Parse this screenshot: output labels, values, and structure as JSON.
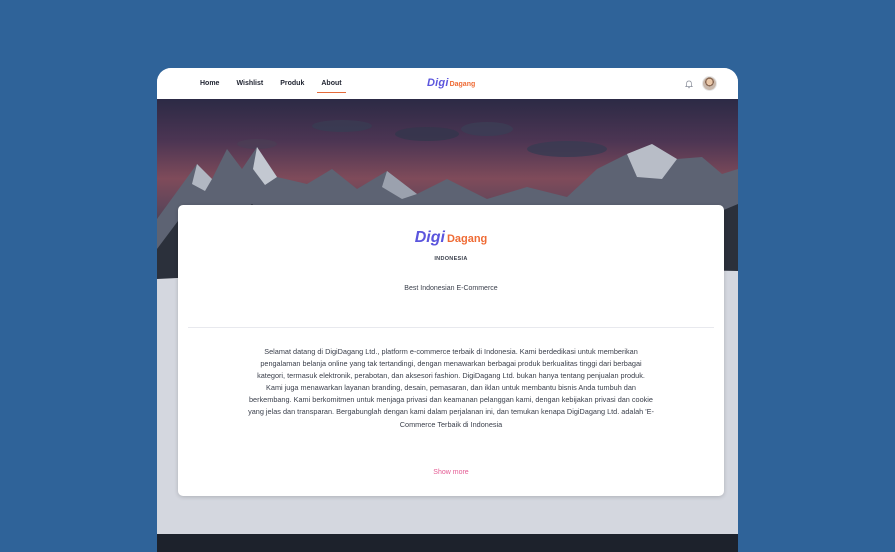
{
  "nav": {
    "links": [
      {
        "label": "Home",
        "active": false
      },
      {
        "label": "Wishlist",
        "active": false
      },
      {
        "label": "Produk",
        "active": false
      },
      {
        "label": "About",
        "active": true
      }
    ],
    "brand": {
      "digi": "Digi",
      "dagang": "Dagang"
    },
    "icons": {
      "notification": "bell-icon",
      "user": "avatar"
    }
  },
  "about": {
    "logo": {
      "digi": "Digi",
      "dagang": "Dagang"
    },
    "country": "INDONESIA",
    "tagline": "Best Indonesian E-Commerce",
    "description": "Selamat datang di DigiDagang Ltd., platform e-commerce terbaik di Indonesia. Kami berdedikasi untuk memberikan pengalaman belanja online yang tak tertandingi, dengan menawarkan berbagai produk berkualitas tinggi dari berbagai kategori, termasuk elektronik, perabotan, dan aksesori fashion. DigiDagang Ltd. bukan hanya tentang penjualan produk. Kami juga menawarkan layanan branding, desain, pemasaran, dan iklan untuk membantu bisnis Anda tumbuh dan berkembang. Kami berkomitmen untuk menjaga privasi dan keamanan pelanggan kami, dengan kebijakan privasi dan cookie yang jelas dan transparan. Bergabunglah dengan kami dalam perjalanan ini, dan temukan kenapa DigiDagang Ltd. adalah 'E-Commerce Terbaik di Indonesia",
    "show_more": "Show more"
  },
  "colors": {
    "background": "#2f6399",
    "brand_primary": "#5b55dd",
    "brand_secondary": "#ef6b35",
    "link_accent": "#e45b93",
    "footer": "#1d222c"
  }
}
